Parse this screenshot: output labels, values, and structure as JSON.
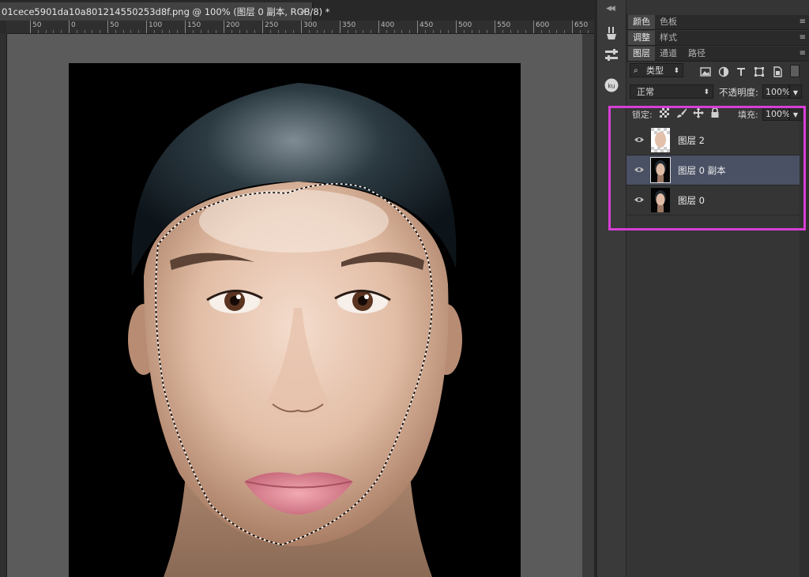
{
  "document": {
    "tab_title": "01cece5901da10a801214550253d8f.png @ 100% (图层 0 副本, RGB/8) *",
    "close_glyph": "×"
  },
  "ruler": {
    "labels": [
      "50",
      "0",
      "50",
      "100",
      "150",
      "200",
      "250",
      "300",
      "350",
      "400",
      "450",
      "500",
      "550",
      "600",
      "650"
    ]
  },
  "panels": {
    "color_tabs": [
      "颜色",
      "色板"
    ],
    "adjust_tabs": [
      "调整",
      "样式"
    ],
    "layer_tabs": [
      "图层",
      "通道",
      "路径"
    ],
    "menu_glyph": "≡"
  },
  "layers_panel": {
    "filter_kind": "类型",
    "blend_mode": "正常",
    "opacity_label": "不透明度:",
    "opacity_value": "100%",
    "lock_label": "锁定:",
    "fill_label": "填充:",
    "fill_value": "100%",
    "layers": [
      {
        "name": "图层 2",
        "selected": false
      },
      {
        "name": "图层 0 副本",
        "selected": true
      },
      {
        "name": "图层 0",
        "selected": false
      }
    ]
  },
  "colors": {
    "selected_layer": "#4a5164",
    "highlight_box": "#d73fd6"
  },
  "icons": {
    "strip": [
      "brush-presets-icon",
      "tool-presets-icon",
      "kuler-icon"
    ],
    "filter": [
      "image-filter-icon",
      "adjustment-filter-icon",
      "type-filter-icon",
      "shape-filter-icon",
      "smart-object-filter-icon"
    ],
    "lock": [
      "lock-pixels-icon",
      "lock-paint-icon",
      "lock-position-icon",
      "lock-all-icon"
    ]
  }
}
